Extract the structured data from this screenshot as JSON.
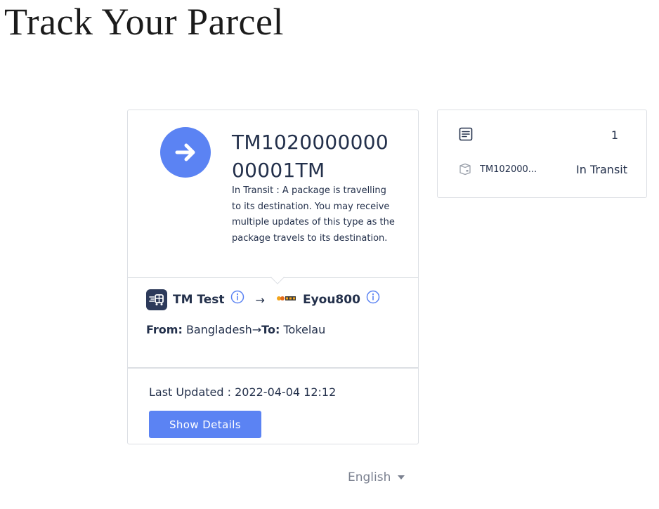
{
  "page": {
    "title": "Track Your Parcel"
  },
  "shipment": {
    "tracking_number": "TM102000000000001TM",
    "status_description": "In Transit : A package is travelling to its destination. You may receive multiple updates of this type as the package travels to its destination.",
    "origin_carrier": {
      "name": "TM Test",
      "icon": "truck-logo-icon"
    },
    "route_arrow": "→",
    "destination_carrier": {
      "name": "Eyou800",
      "icon": "eyou800-logo-icon"
    },
    "from_label": "From:",
    "from_value": "Bangladesh",
    "to_arrow": "→",
    "to_label": "To:",
    "to_value": "Tokelau",
    "last_updated": "Last Updated : 2022-04-04 12:12",
    "show_details_label": "Show Details",
    "status_icon": "arrow-right-icon"
  },
  "sidebar": {
    "count": "1",
    "list_icon": "document-list-icon",
    "parcels": [
      {
        "number": "TM102000...",
        "status": "In Transit",
        "icon": "box-icon"
      }
    ]
  },
  "footer": {
    "language": "English"
  },
  "colors": {
    "accent": "#5b83f3",
    "text": "#23304b",
    "muted": "#7b8190",
    "border": "#dcdfe4"
  }
}
